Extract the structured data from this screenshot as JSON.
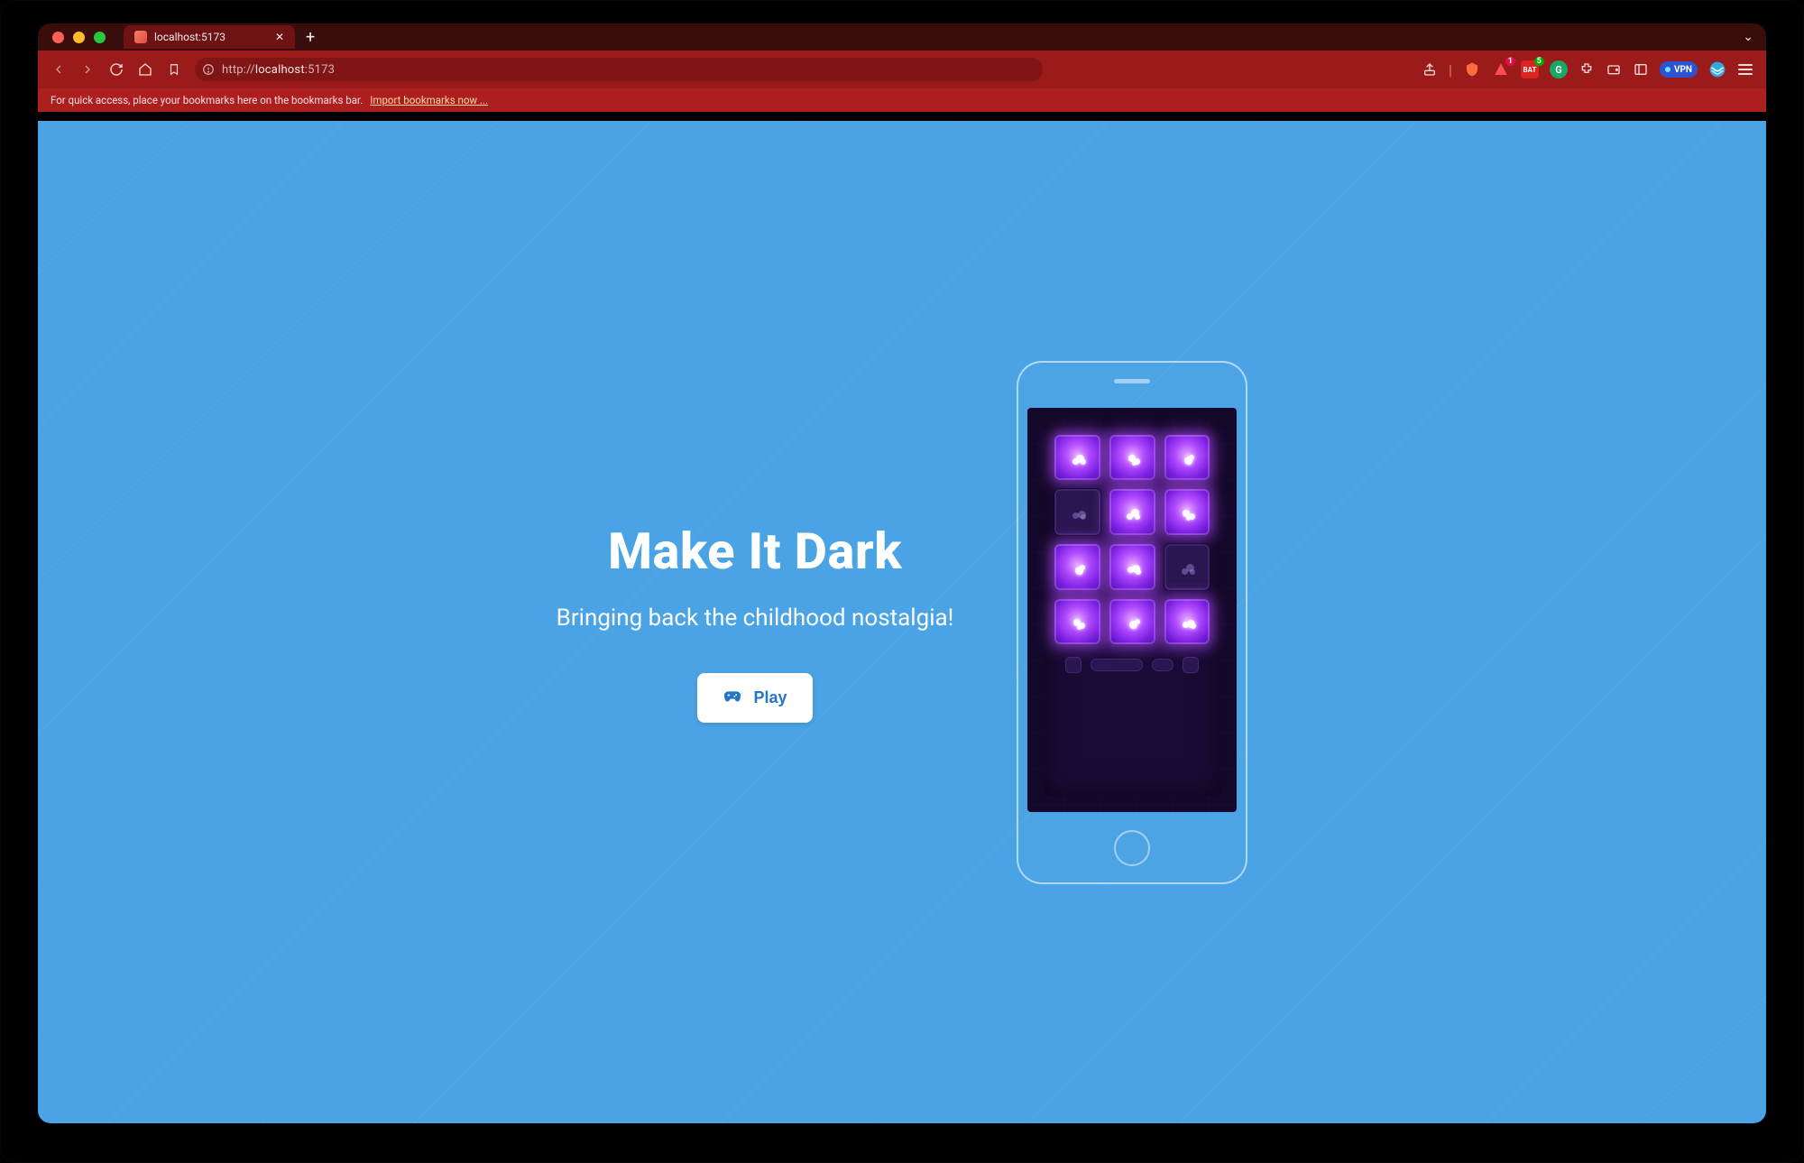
{
  "browser": {
    "tab_title": "localhost:5173",
    "url_scheme": "http://",
    "url_host": "localhost",
    "url_port": ":5173",
    "bookmarks_hint": "For quick access, place your bookmarks here on the bookmarks bar.",
    "bookmarks_link": "Import bookmarks now ...",
    "vpn_label": "VPN",
    "brave_badge": "1",
    "rewards_badge": "5"
  },
  "hero": {
    "title": "Make It Dark",
    "tagline": "Bringing back the childhood nostalgia!",
    "play_label": "Play"
  },
  "game": {
    "grid": [
      [
        true,
        true,
        true
      ],
      [
        false,
        true,
        true
      ],
      [
        true,
        true,
        false
      ],
      [
        true,
        true,
        true
      ]
    ]
  },
  "colors": {
    "page_bg": "#4aa3e4",
    "chrome_tabstrip": "#3a0d0d",
    "chrome_toolbar": "#9b1a1a",
    "chrome_bookbar": "#ad1f1f",
    "accent": "#2575c7",
    "tile_on": "#b24cff",
    "tile_off": "#2a1650"
  }
}
